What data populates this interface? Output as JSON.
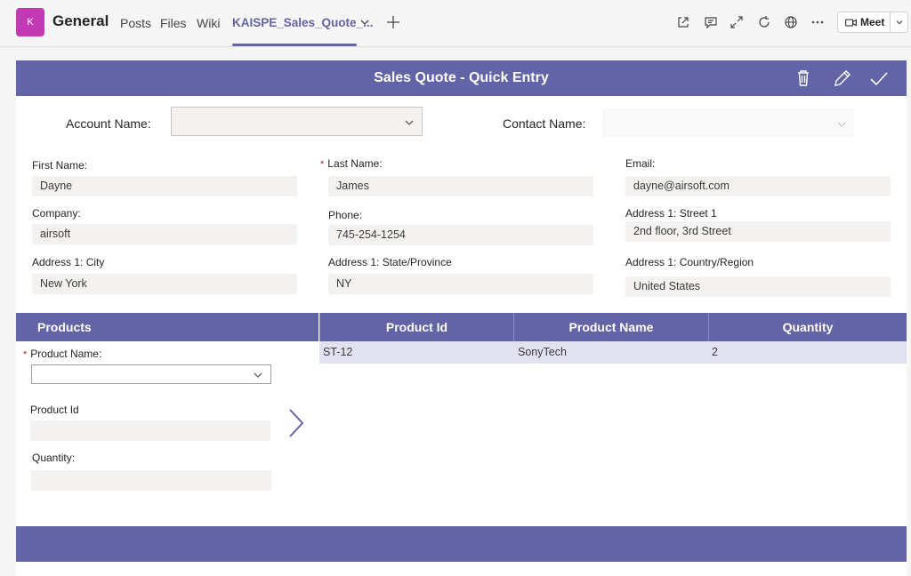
{
  "teams": {
    "avatar_letter": "K",
    "channel": "General",
    "tabs": [
      {
        "label": "Posts"
      },
      {
        "label": "Files"
      },
      {
        "label": "Wiki"
      },
      {
        "label": "KAISPE_Sales_Quote_..."
      }
    ],
    "meet_label": "Meet",
    "accent": "#6264a7"
  },
  "app": {
    "title": "Sales Quote - Quick Entry",
    "account_label": "Account Name:",
    "account_value": "",
    "contact_label": "Contact Name:",
    "contact_value": "",
    "fields": {
      "first_name": {
        "label": "First Name:",
        "value": "Dayne"
      },
      "last_name": {
        "label": "Last Name:",
        "value": "James",
        "required": "*"
      },
      "email": {
        "label": "Email:",
        "value": "dayne@airsoft.com"
      },
      "company": {
        "label": "Company:",
        "value": "airsoft"
      },
      "phone": {
        "label": "Phone:",
        "value": "745-254-1254"
      },
      "street": {
        "label": "Address 1: Street 1",
        "value": "2nd floor, 3rd Street"
      },
      "city": {
        "label": "Address 1: City",
        "value": "New York"
      },
      "state": {
        "label": "Address 1: State/Province",
        "value": "NY"
      },
      "country": {
        "label": "Address 1: Country/Region",
        "value": "United States"
      }
    },
    "products": {
      "header": "Products",
      "product_name_label": "Product Name:",
      "product_name_required": "*",
      "product_id_label": "Product Id",
      "quantity_label": "Quantity:"
    },
    "grid": {
      "columns": [
        "Product Id",
        "Product Name",
        "Quantity"
      ],
      "rows": [
        [
          "ST-12",
          "SonyTech",
          "2"
        ]
      ]
    }
  }
}
